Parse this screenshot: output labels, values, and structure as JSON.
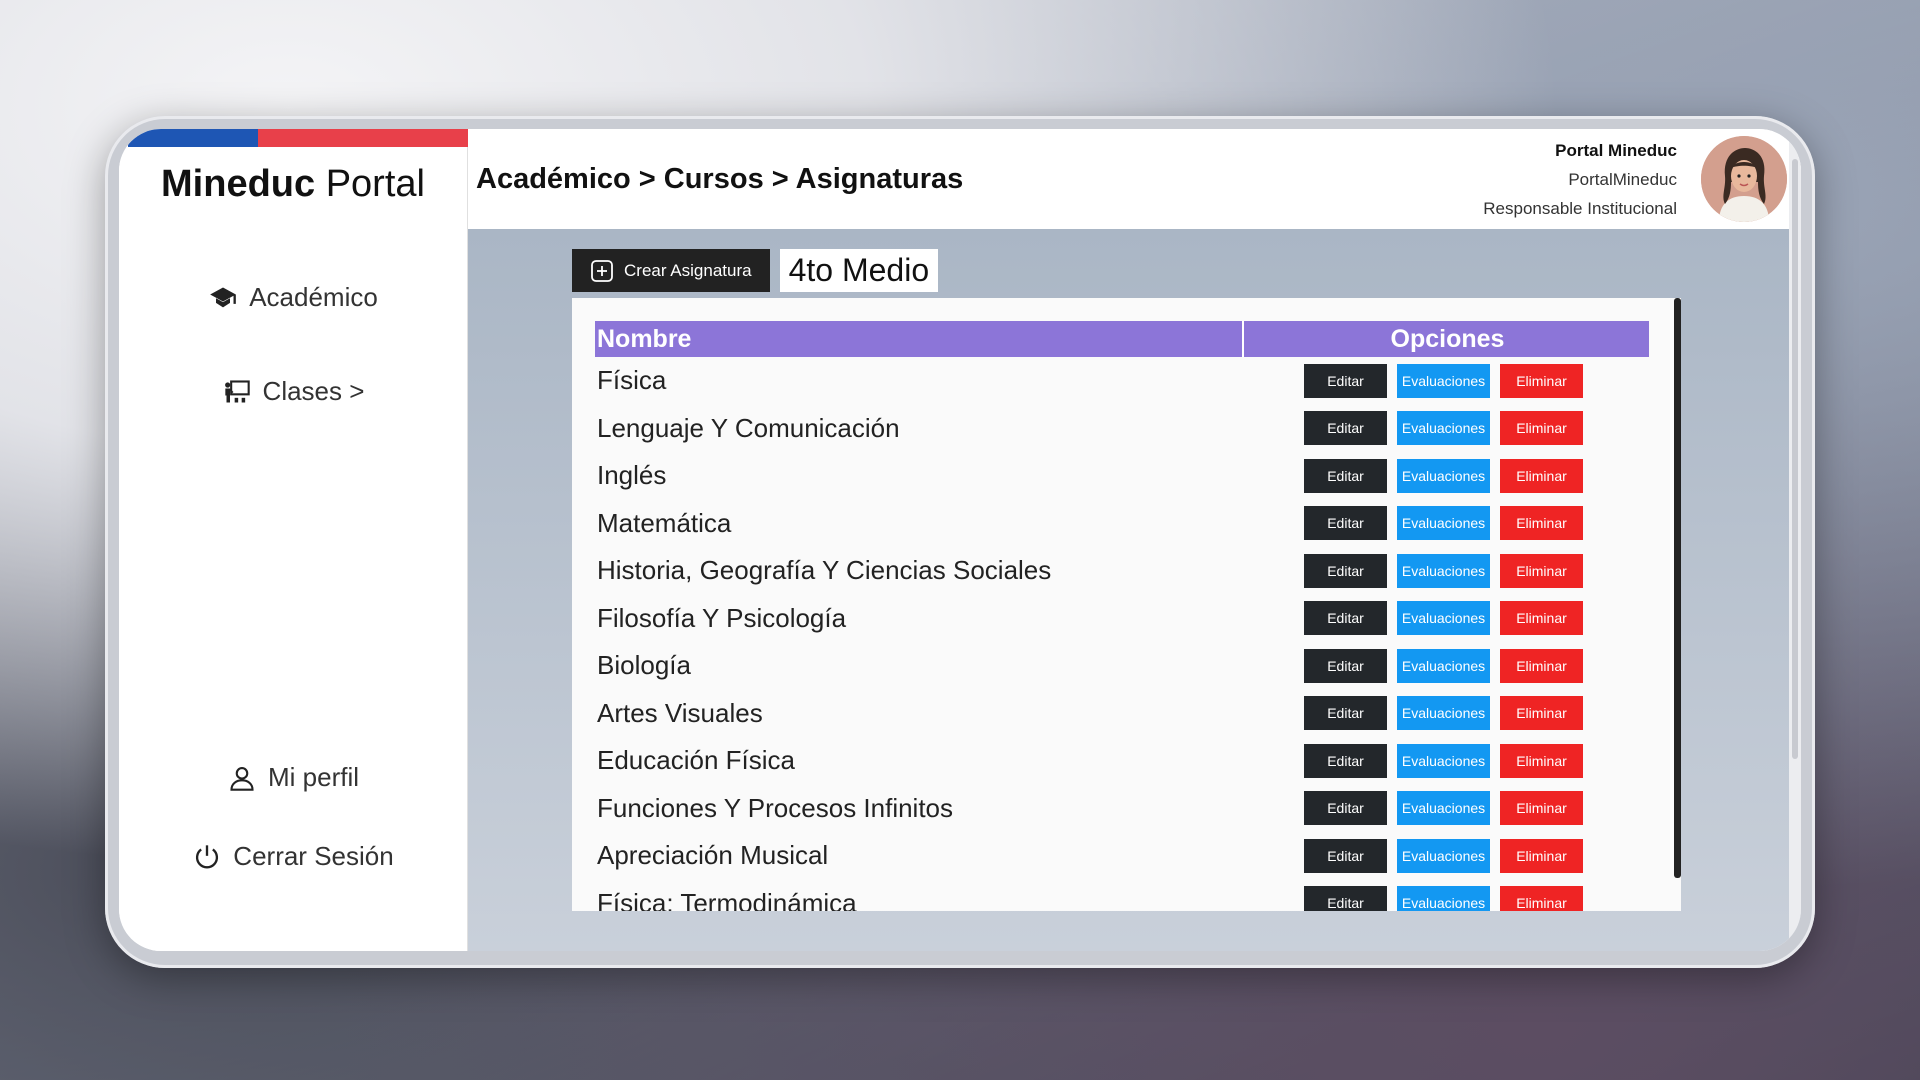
{
  "brand": {
    "bold": "Mineduc",
    "light": "Portal"
  },
  "sidebar": {
    "items": [
      {
        "label": "Académico",
        "icon": "graduation-cap-icon"
      },
      {
        "label": "Clases >",
        "icon": "teacher-board-icon"
      }
    ],
    "bottom": [
      {
        "label": "Mi perfil",
        "icon": "user-icon"
      },
      {
        "label": "Cerrar Sesión",
        "icon": "power-icon"
      }
    ]
  },
  "header": {
    "breadcrumb": "Académico > Cursos > Asignaturas",
    "user": {
      "name": "Portal Mineduc",
      "username": "PortalMineduc",
      "role": "Responsable Institucional"
    }
  },
  "toolbar": {
    "create_label": "Crear Asignatura",
    "level": "4to Medio"
  },
  "table": {
    "headers": {
      "name": "Nombre",
      "options": "Opciones"
    },
    "actions": {
      "edit": "Editar",
      "evaluations": "Evaluaciones",
      "delete": "Eliminar"
    },
    "rows": [
      "Física",
      "Lenguaje Y Comunicación",
      "Inglés",
      "Matemática",
      "Historia, Geografía Y Ciencias Sociales",
      "Filosofía Y Psicología",
      "Biología",
      "Artes Visuales",
      "Educación Física",
      "Funciones Y Procesos Infinitos",
      "Apreciación Musical",
      "Física: Termodinámica"
    ]
  },
  "colors": {
    "header": "#8c75d8",
    "edit": "#23272b",
    "evaluations": "#1398f2",
    "delete": "#ef2424",
    "flag_blue": "#1e56b4",
    "flag_red": "#e8404a"
  }
}
